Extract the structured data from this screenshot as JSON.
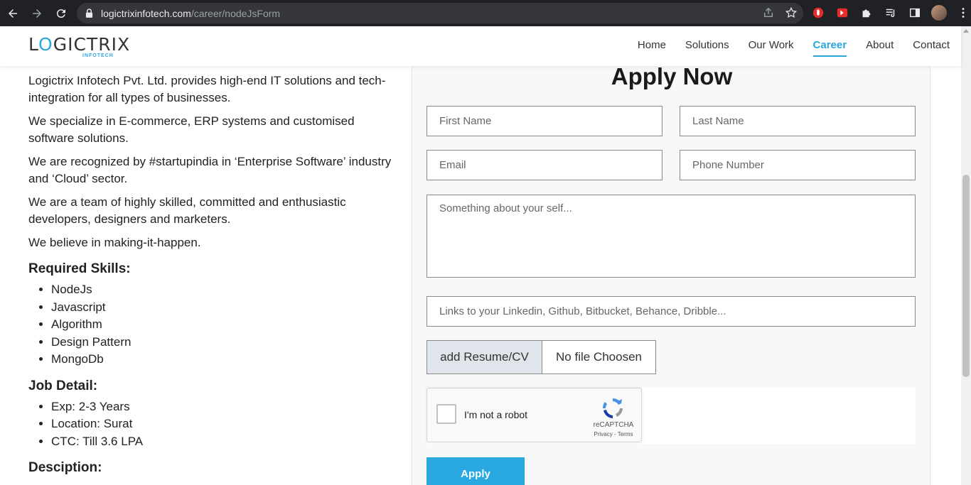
{
  "browser": {
    "url_domain": "logictrixinfotech.com",
    "url_path": "/career/nodeJsForm"
  },
  "site": {
    "logo_main_prefix": "L",
    "logo_main_o": "O",
    "logo_main_suffix": "GICTRIX",
    "logo_sub": "INFOTECH",
    "nav": {
      "home": "Home",
      "solutions": "Solutions",
      "our_work": "Our Work",
      "career": "Career",
      "about": "About",
      "contact": "Contact"
    },
    "accent_color": "#29a8e0"
  },
  "intro": {
    "p1": "Logictrix Infotech Pvt. Ltd. provides high-end IT solutions and tech-integration for all types of businesses.",
    "p2": "We specialize in E-commerce, ERP systems and customised software solutions.",
    "p3": "We are recognized by #startupindia in ‘Enterprise Software’ industry and ‘Cloud’ sector.",
    "p4": "We are a team of highly skilled, committed and enthusiastic developers, designers and marketers.",
    "p5": "We believe in making-it-happen."
  },
  "skills": {
    "heading": "Required Skills:",
    "items": [
      "NodeJs",
      "Javascript",
      "Algorithm",
      "Design Pattern",
      "MongoDb"
    ]
  },
  "job": {
    "heading": "Job Detail:",
    "items": [
      "Exp: 2-3 Years",
      "Location: Surat",
      "CTC: Till 3.6 LPA"
    ]
  },
  "description_heading": "Desciption:",
  "form": {
    "title": "Apply Now",
    "first_name": "First Name",
    "last_name": "Last Name",
    "email": "Email",
    "phone": "Phone Number",
    "about": "Something about your self...",
    "links": "Links to your Linkedin, Github, Bitbucket, Behance, Dribble...",
    "file_button": "add Resume/CV",
    "file_status": "No file Choosen",
    "captcha_label": "I'm not a robot",
    "captcha_brand": "reCAPTCHA",
    "captcha_links": "Privacy - Terms",
    "submit": "Apply"
  }
}
